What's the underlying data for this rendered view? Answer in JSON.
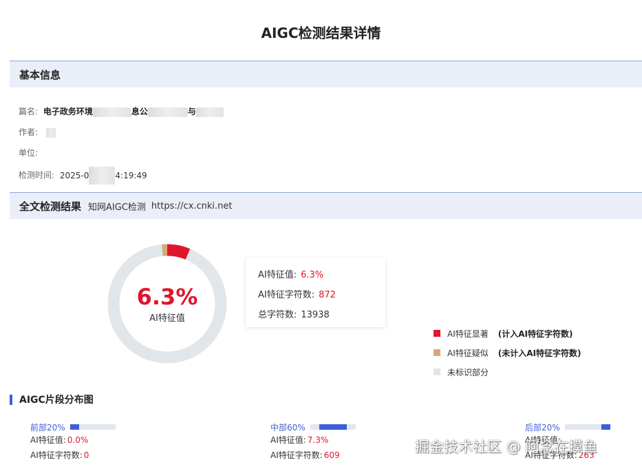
{
  "page": {
    "title": "AIGC检测结果详情"
  },
  "basic_info": {
    "header": "基本信息",
    "title_label": "篇名:",
    "title_value_a": "电子政务环境",
    "title_value_b": "息公",
    "title_value_c": "与",
    "author_label": "作者:",
    "unit_label": "单位:",
    "time_label": "检测时间:",
    "time_value_a": "2025-0",
    "time_value_b": "4:19:49"
  },
  "result": {
    "header": "全文检测结果",
    "source": "知网AIGC检测",
    "url": "https://cx.cnki.net",
    "ai_percent_text": "6.3%",
    "ai_label": "AI特征值",
    "stats": {
      "ai_value_label": "AI特征值:",
      "ai_value": "6.3%",
      "ai_chars_label": "AI特征字符数:",
      "ai_chars": "872",
      "total_chars_label": "总字符数:",
      "total_chars": "13938"
    },
    "legend": [
      {
        "label": "AI特征显著",
        "note": "(计入AI特征字符数)",
        "color": "#e0162b"
      },
      {
        "label": "AI特征疑似",
        "note": "(未计入AI特征字符数)",
        "color": "#d4aa78"
      },
      {
        "label": "未标识部分",
        "note": "",
        "color": "#e1e6ea"
      }
    ]
  },
  "chart_data": {
    "type": "pie",
    "categories": [
      "AI特征显著",
      "AI特征疑似",
      "未标识部分"
    ],
    "values": [
      6.3,
      1.5,
      92.2
    ],
    "colors": [
      "#e0162b",
      "#d4aa78",
      "#e1e6ea"
    ]
  },
  "distribution": {
    "title": "AIGC片段分布图",
    "segments": [
      {
        "name": "前部20%",
        "ai_value_label": "AI特征值:",
        "ai_value": "0.0%",
        "ai_chars_label": "AI特征字符数:",
        "ai_chars": "0",
        "bar_start": 0.0,
        "bar_fill": 0.2
      },
      {
        "name": "中部60%",
        "ai_value_label": "AI特征值:",
        "ai_value": "7.3%",
        "ai_chars_label": "AI特征字符数:",
        "ai_chars": "609",
        "bar_start": 0.2,
        "bar_fill": 0.6
      },
      {
        "name": "后部20%",
        "ai_value_label": "AI特征值:",
        "ai_value": "",
        "ai_chars_label": "AI特征字符数:",
        "ai_chars": "263",
        "bar_start": 0.8,
        "bar_fill": 0.2
      }
    ]
  },
  "watermark": "掘金技术社区 @ 阿念在摸鱼"
}
